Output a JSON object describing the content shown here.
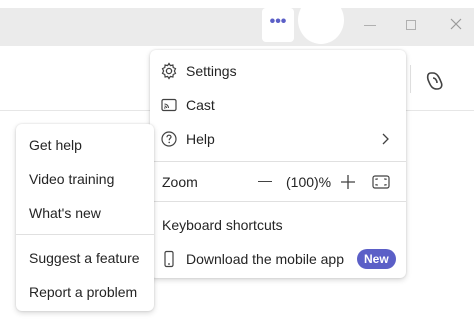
{
  "colors": {
    "accent": "#5b5fc7",
    "titlebar": "#ebebeb",
    "menu_bg": "#ffffff",
    "separator": "#e0e0e0",
    "text": "#242424"
  },
  "titlebar": {
    "more_label": "•••",
    "icons": [
      "more-options-icon",
      "avatar",
      "minimize-icon",
      "maximize-icon",
      "close-icon"
    ]
  },
  "toolbar": {
    "icons": [
      "copilot-icon"
    ]
  },
  "main_menu": {
    "settings": {
      "label": "Settings",
      "icon": "gear-icon"
    },
    "cast": {
      "label": "Cast",
      "icon": "cast-icon"
    },
    "help": {
      "label": "Help",
      "icon": "help-circle-icon",
      "submenu_icon": "chevron-right-icon"
    },
    "zoom": {
      "label": "Zoom",
      "value": "(100)%",
      "icons": [
        "minus-icon",
        "plus-icon",
        "fit-screen-icon"
      ]
    },
    "keyboard_shortcuts": {
      "label": "Keyboard shortcuts"
    },
    "mobile_app": {
      "label": "Download the mobile app",
      "icon": "phone-icon",
      "badge": "New"
    }
  },
  "help_menu": {
    "items": [
      {
        "label": "Get help"
      },
      {
        "label": "Video training"
      },
      {
        "label": "What's new"
      },
      {
        "label": "Suggest a feature"
      },
      {
        "label": "Report a problem"
      }
    ]
  }
}
